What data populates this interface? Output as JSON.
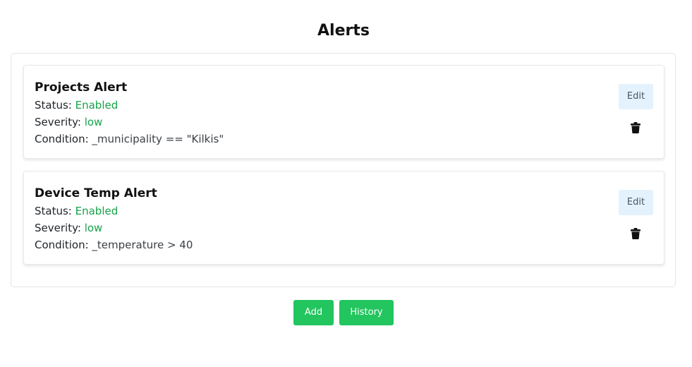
{
  "page": {
    "title": "Alerts"
  },
  "labels": {
    "status": "Status: ",
    "severity": "Severity: ",
    "condition": "Condition: ",
    "edit": "Edit"
  },
  "alerts": [
    {
      "name": "Projects Alert",
      "status": "Enabled",
      "severity": "low",
      "condition": "_municipality == \"Kilkis\""
    },
    {
      "name": "Device Temp Alert",
      "status": "Enabled",
      "severity": "low",
      "condition": "_temperature > 40"
    }
  ],
  "actions": {
    "add_label": "Add",
    "history_label": "History"
  },
  "colors": {
    "accent_green": "#22c55e",
    "status_green": "#16a34a",
    "edit_bg": "#e3f2fd"
  },
  "icons": {
    "delete": "trash-icon"
  }
}
